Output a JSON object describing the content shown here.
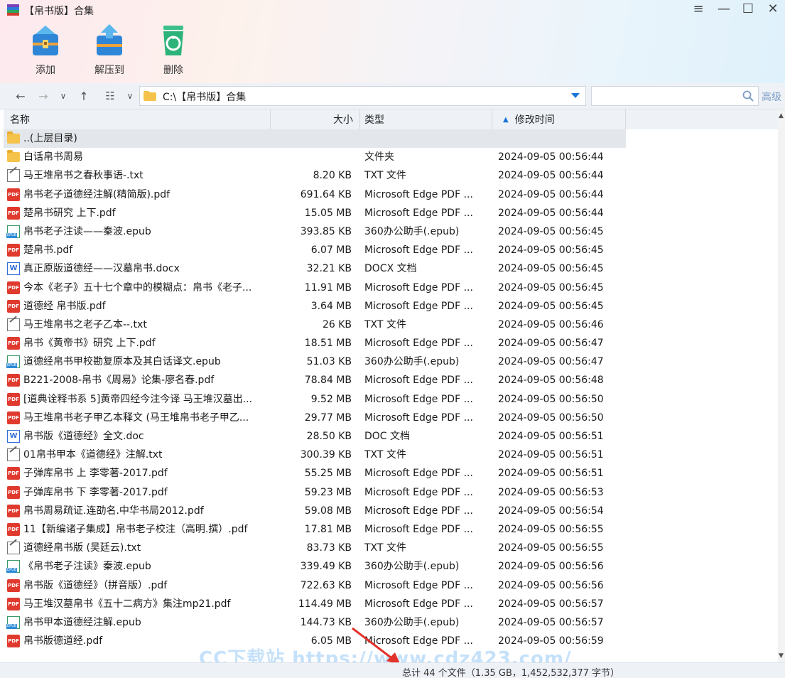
{
  "window": {
    "title": "【帛书版】合集",
    "controls": [
      "≡",
      "—",
      "☐",
      "✕"
    ]
  },
  "toolbar": {
    "add_label": "添加",
    "extract_label": "解压到",
    "delete_label": "删除"
  },
  "address": {
    "path": "C:\\【帛书版】合集",
    "search_placeholder": "",
    "advanced_label": "高级"
  },
  "columns": {
    "name": "名称",
    "size": "大小",
    "type": "类型",
    "time": "修改时间"
  },
  "rows": [
    {
      "name": "..(上层目录)",
      "size": "",
      "type": "",
      "time": "",
      "icon": "folder",
      "selected": true
    },
    {
      "name": "白话帛书周易",
      "size": "",
      "type": "文件夹",
      "time": "2024-09-05 00:56:44",
      "icon": "folder"
    },
    {
      "name": "马王堆帛书之春秋事语-.txt",
      "size": "8.20 KB",
      "type": "TXT 文件",
      "time": "2024-09-05 00:56:44",
      "icon": "txt"
    },
    {
      "name": "帛书老子道德经注解(精简版).pdf",
      "size": "691.64 KB",
      "type": "Microsoft Edge PDF ...",
      "time": "2024-09-05 00:56:44",
      "icon": "pdf"
    },
    {
      "name": "楚帛书研究 上下.pdf",
      "size": "15.05 MB",
      "type": "Microsoft Edge PDF ...",
      "time": "2024-09-05 00:56:44",
      "icon": "pdf"
    },
    {
      "name": "帛书老子注读——秦波.epub",
      "size": "393.85 KB",
      "type": "360办公助手(.epub)",
      "time": "2024-09-05 00:56:45",
      "icon": "epub"
    },
    {
      "name": "楚帛书.pdf",
      "size": "6.07 MB",
      "type": "Microsoft Edge PDF ...",
      "time": "2024-09-05 00:56:45",
      "icon": "pdf"
    },
    {
      "name": "真正原版道德经——汉墓帛书.docx",
      "size": "32.21 KB",
      "type": "DOCX 文档",
      "time": "2024-09-05 00:56:45",
      "icon": "doc"
    },
    {
      "name": "今本《老子》五十七个章中的模糊点：帛书《老子...",
      "size": "11.91 MB",
      "type": "Microsoft Edge PDF ...",
      "time": "2024-09-05 00:56:45",
      "icon": "pdf"
    },
    {
      "name": "道德经 帛书版.pdf",
      "size": "3.64 MB",
      "type": "Microsoft Edge PDF ...",
      "time": "2024-09-05 00:56:45",
      "icon": "pdf"
    },
    {
      "name": "马王堆帛书之老子乙本--.txt",
      "size": "26 KB",
      "type": "TXT 文件",
      "time": "2024-09-05 00:56:46",
      "icon": "txt"
    },
    {
      "name": "帛书《黄帝书》研究 上下.pdf",
      "size": "18.51 MB",
      "type": "Microsoft Edge PDF ...",
      "time": "2024-09-05 00:56:47",
      "icon": "pdf"
    },
    {
      "name": "道德经帛书甲校勘复原本及其白话译文.epub",
      "size": "51.03 KB",
      "type": "360办公助手(.epub)",
      "time": "2024-09-05 00:56:47",
      "icon": "epub"
    },
    {
      "name": "B221-2008-帛书《周易》论集-廖名春.pdf",
      "size": "78.84 MB",
      "type": "Microsoft Edge PDF ...",
      "time": "2024-09-05 00:56:48",
      "icon": "pdf"
    },
    {
      "name": "[道典诠释书系 5]黄帝四经今注今译 马王堆汉墓出...",
      "size": "9.52 MB",
      "type": "Microsoft Edge PDF ...",
      "time": "2024-09-05 00:56:50",
      "icon": "pdf"
    },
    {
      "name": "马王堆帛书老子甲乙本释文 (马王堆帛书老子甲乙...",
      "size": "29.77 MB",
      "type": "Microsoft Edge PDF ...",
      "time": "2024-09-05 00:56:50",
      "icon": "pdf"
    },
    {
      "name": "帛书版《道德经》全文.doc",
      "size": "28.50 KB",
      "type": "DOC 文档",
      "time": "2024-09-05 00:56:51",
      "icon": "doc"
    },
    {
      "name": "01帛书甲本《道德经》注解.txt",
      "size": "300.39 KB",
      "type": "TXT 文件",
      "time": "2024-09-05 00:56:51",
      "icon": "txt"
    },
    {
      "name": "子弹库帛书 上 李零著-2017.pdf",
      "size": "55.25 MB",
      "type": "Microsoft Edge PDF ...",
      "time": "2024-09-05 00:56:51",
      "icon": "pdf"
    },
    {
      "name": "子弹库帛书 下 李零著-2017.pdf",
      "size": "59.23 MB",
      "type": "Microsoft Edge PDF ...",
      "time": "2024-09-05 00:56:53",
      "icon": "pdf"
    },
    {
      "name": "帛书周易疏证.连劭名.中华书局2012.pdf",
      "size": "59.08 MB",
      "type": "Microsoft Edge PDF ...",
      "time": "2024-09-05 00:56:54",
      "icon": "pdf"
    },
    {
      "name": "11【新编诸子集成】帛书老子校注（高明.撰）.pdf",
      "size": "17.81 MB",
      "type": "Microsoft Edge PDF ...",
      "time": "2024-09-05 00:56:55",
      "icon": "pdf"
    },
    {
      "name": "道德经帛书版 (吴廷云).txt",
      "size": "83.73 KB",
      "type": "TXT 文件",
      "time": "2024-09-05 00:56:55",
      "icon": "txt"
    },
    {
      "name": "《帛书老子注读》秦波.epub",
      "size": "339.49 KB",
      "type": "360办公助手(.epub)",
      "time": "2024-09-05 00:56:56",
      "icon": "epub"
    },
    {
      "name": "帛书版《道德经》（拼音版）.pdf",
      "size": "722.63 KB",
      "type": "Microsoft Edge PDF ...",
      "time": "2024-09-05 00:56:56",
      "icon": "pdf"
    },
    {
      "name": "马王堆汉墓帛书《五十二病方》集注mp21.pdf",
      "size": "114.49 MB",
      "type": "Microsoft Edge PDF ...",
      "time": "2024-09-05 00:56:57",
      "icon": "pdf"
    },
    {
      "name": "帛书甲本道德经注解.epub",
      "size": "144.73 KB",
      "type": "360办公助手(.epub)",
      "time": "2024-09-05 00:56:57",
      "icon": "epub"
    },
    {
      "name": "帛书版德道经.pdf",
      "size": "6.05 MB",
      "type": "Microsoft Edge PDF ...",
      "time": "2024-09-05 00:56:59",
      "icon": "pdf"
    }
  ],
  "status": {
    "text": "总计 44 个文件（1.35 GB，1,452,532,377 字节）"
  },
  "watermark": {
    "text": "CC下载站 https://www.cdz423.com/"
  },
  "colors": {
    "accent": "#1a73d9",
    "pdf_icon": "#e03a2f",
    "folder_icon": "#f5c34a"
  }
}
